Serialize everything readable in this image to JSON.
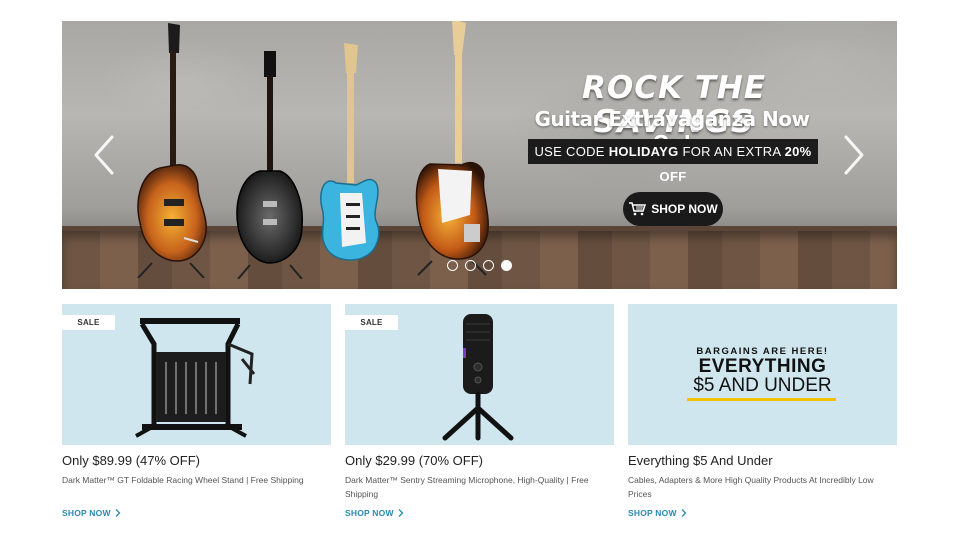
{
  "hero": {
    "headline": "ROCK THE SAVINGS",
    "subline": "Guitar Extravaganza Now On!",
    "code_prefix": "USE CODE",
    "code": "HOLIDAYG",
    "code_mid": "FOR AN EXTRA",
    "code_percent": "20% OFF",
    "cta_label": "SHOP NOW",
    "slide_count": 4,
    "active_slide": 4,
    "icons": [
      "chevron-left-icon",
      "chevron-right-icon",
      "cart-icon"
    ]
  },
  "cards": [
    {
      "badge": "SALE",
      "title": "Only $89.99 (47% OFF)",
      "description": "Dark Matter™ GT Foldable Racing Wheel Stand | Free Shipping",
      "link": "SHOP NOW"
    },
    {
      "badge": "SALE",
      "title": "Only $29.99 (70% OFF)",
      "description": "Dark Matter™ Sentry Streaming Microphone, High-Quality | Free Shipping",
      "link": "SHOP NOW"
    },
    {
      "banner_small": "BARGAINS ARE HERE!",
      "banner_big": "EVERYTHING",
      "banner_big2": "$5 AND UNDER",
      "title": "Everything $5 And Under",
      "description": "Cables, Adapters & More High Quality Products At Incredibly Low Prices",
      "link": "SHOP NOW"
    }
  ],
  "colors": {
    "card_bg": "#cfe6ee",
    "link": "#2a8bb0",
    "accent_yellow": "#f2c200",
    "dark": "#1a1a1a"
  }
}
